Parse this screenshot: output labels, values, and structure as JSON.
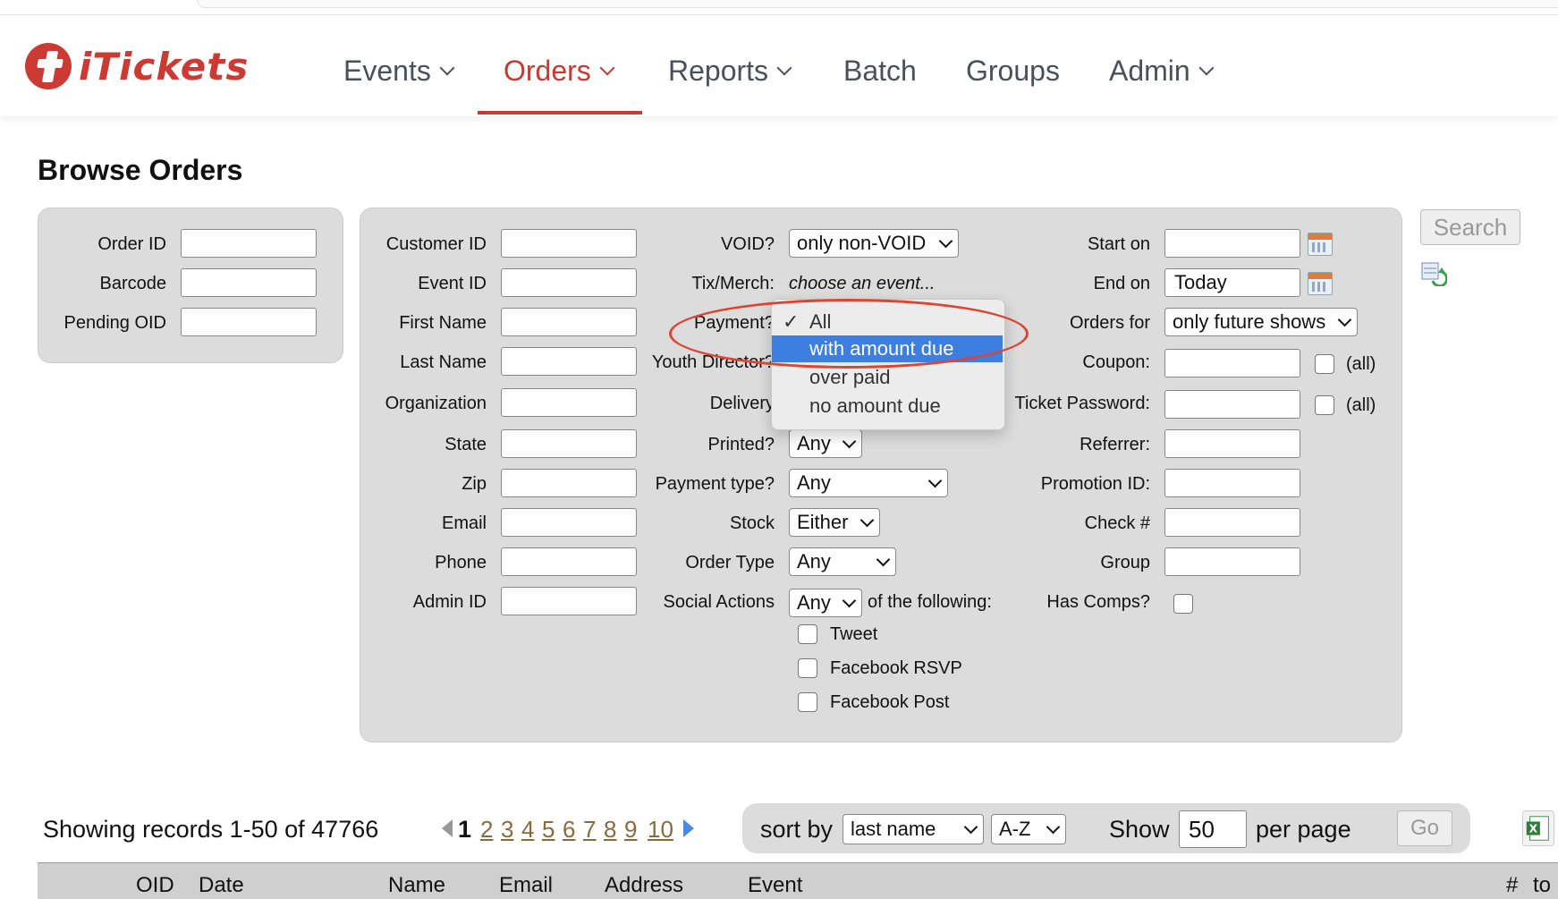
{
  "nav": {
    "logo_text": "iTickets",
    "items": [
      {
        "label": "Events",
        "dropdown": true
      },
      {
        "label": "Orders",
        "dropdown": true,
        "active": true
      },
      {
        "label": "Reports",
        "dropdown": true
      },
      {
        "label": "Batch",
        "dropdown": false
      },
      {
        "label": "Groups",
        "dropdown": false
      },
      {
        "label": "Admin",
        "dropdown": true
      }
    ]
  },
  "page": {
    "title": "Browse Orders"
  },
  "left_panel": {
    "order_id_label": "Order ID",
    "barcode_label": "Barcode",
    "pending_oid_label": "Pending OID"
  },
  "col1": {
    "customer_id": "Customer ID",
    "event_id": "Event ID",
    "first_name": "First Name",
    "last_name": "Last Name",
    "organization": "Organization",
    "state": "State",
    "zip": "Zip",
    "email": "Email",
    "phone": "Phone",
    "admin_id": "Admin ID"
  },
  "col2": {
    "void_label": "VOID?",
    "void_value": "only non-VOID",
    "tixmerch_label": "Tix/Merch:",
    "tixmerch_value": "choose an event...",
    "payment_label": "Payment?",
    "youth_label": "Youth Director?",
    "delivery_label": "Delivery",
    "printed_label": "Printed?",
    "printed_value": "Any",
    "paytype_label": "Payment type?",
    "paytype_value": "Any",
    "stock_label": "Stock",
    "stock_value": "Either",
    "ordertype_label": "Order Type",
    "ordertype_value": "Any",
    "social_label": "Social Actions",
    "social_value": "Any",
    "social_suffix": "of the following:",
    "tweet": "Tweet",
    "fb_rsvp": "Facebook RSVP",
    "fb_post": "Facebook Post"
  },
  "col3": {
    "start_label": "Start on",
    "end_label": "End on",
    "end_value": "Today",
    "orders_for_label": "Orders for",
    "orders_for_value": "only future shows",
    "coupon_label": "Coupon:",
    "all_label": "(all)",
    "ticket_pw_label": "Ticket Password:",
    "referrer_label": "Referrer:",
    "promo_label": "Promotion ID:",
    "check_label": "Check #",
    "group_label": "Group",
    "has_comps_label": "Has Comps?"
  },
  "search_button": "Search",
  "payment_dropdown": {
    "options": [
      {
        "label": "All",
        "checked": true
      },
      {
        "label": "with amount due",
        "highlighted": true
      },
      {
        "label": "over paid"
      },
      {
        "label": "no amount due"
      }
    ],
    "check_glyph": "✓"
  },
  "results": {
    "showing": "Showing records 1-50 of 47766",
    "current_page": "1",
    "pages": [
      "2",
      "3",
      "4",
      "5",
      "6",
      "7",
      "8",
      "9",
      "10"
    ],
    "sort_by_label": "sort by",
    "sort_field": "last name",
    "sort_dir": "A-Z",
    "show_label": "Show",
    "per_page_value": "50",
    "per_page_label": "per page",
    "go_button": "Go"
  },
  "table_headers": [
    "OID",
    "Date",
    "Name",
    "Email",
    "Address",
    "Event",
    "#",
    "to"
  ],
  "colors": {
    "brand": "#cc3b33",
    "active_nav": "#c8392f",
    "highlight": "#3d7ee0",
    "annotation": "#e0432f"
  }
}
